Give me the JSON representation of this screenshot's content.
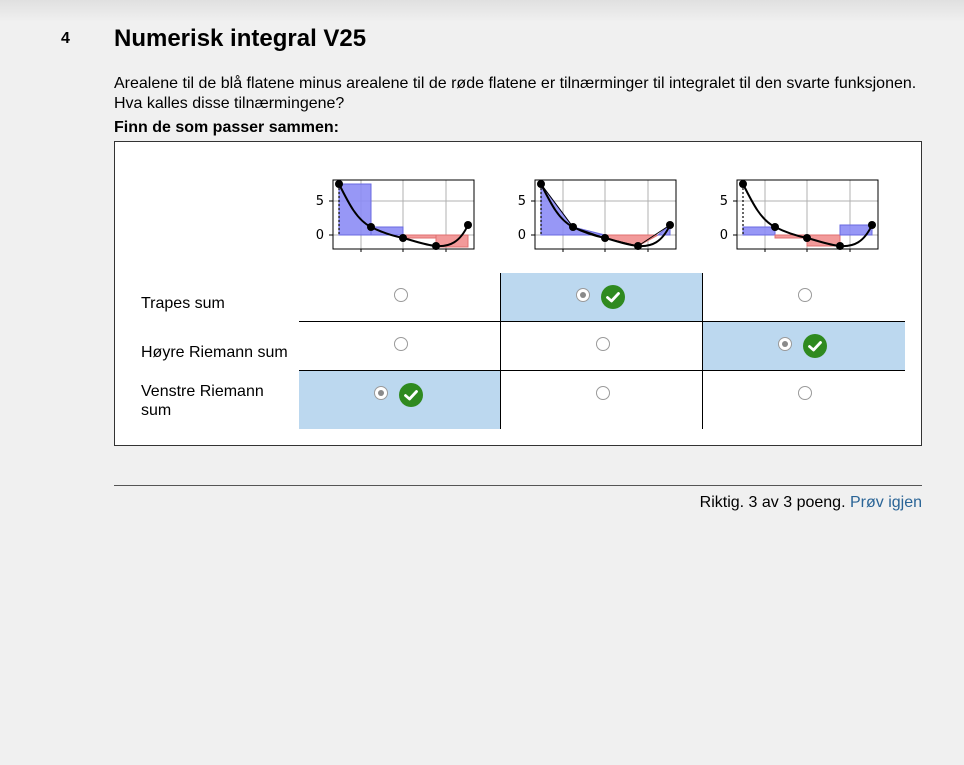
{
  "question": {
    "number": "4",
    "title": "Numerisk integral V25",
    "text_line1": "Arealene til de blå flatene minus arealene til de røde flatene er tilnærminger til integralet til den svarte funksjonen.",
    "text_line2": "Hva kalles disse tilnærmingene?",
    "hint": "Finn de som passer sammen:"
  },
  "plots": [
    {
      "method": "left-riemann",
      "y_ticks": [
        "5",
        "0"
      ]
    },
    {
      "method": "trapezoid",
      "y_ticks": [
        "5",
        "0"
      ]
    },
    {
      "method": "right-riemann",
      "y_ticks": [
        "5",
        "0"
      ]
    }
  ],
  "rows": [
    {
      "label": "Trapes sum",
      "selected_col": 1
    },
    {
      "label": "Høyre Riemann sum",
      "selected_col": 2
    },
    {
      "label": "Venstre Riemann sum",
      "selected_col": 0
    }
  ],
  "colors": {
    "positive_area": "#8c8cf5",
    "negative_area": "#f29a9a",
    "selected_cell": "#bcd8ef",
    "check_icon": "#2f8a1f",
    "link": "#2a6496"
  },
  "footer": {
    "result_text": "Riktig. 3 av 3 poeng.",
    "retry_label": "Prøv igjen"
  }
}
